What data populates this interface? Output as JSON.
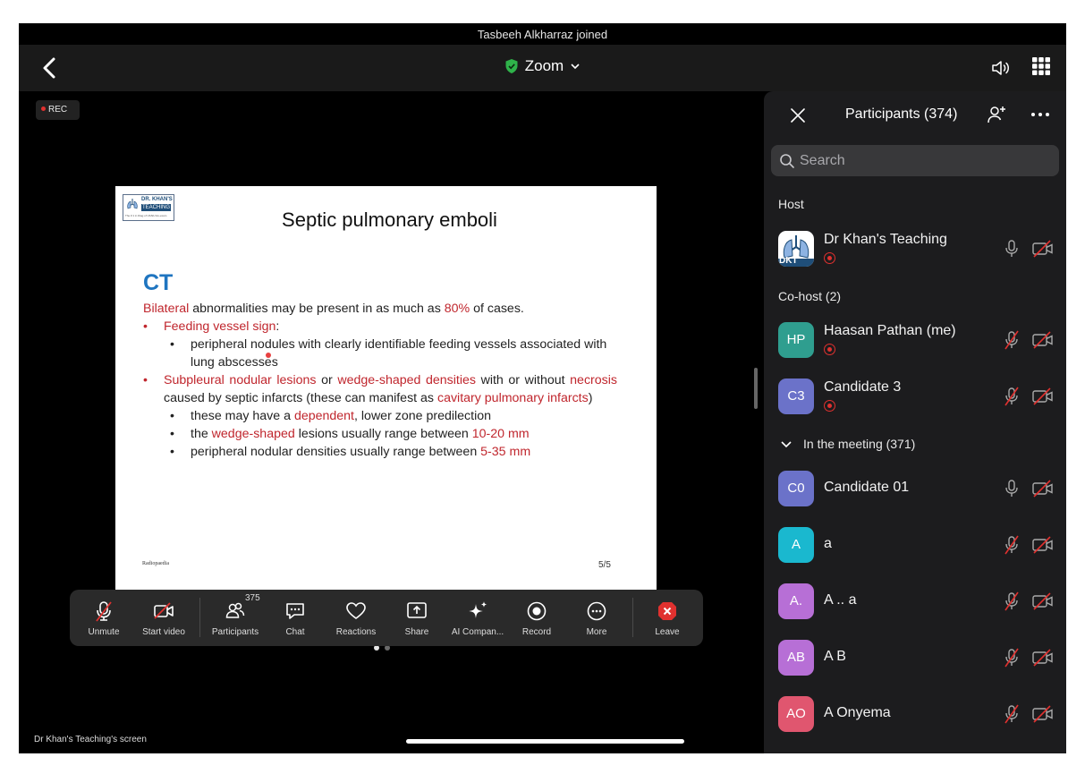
{
  "notification": "Tasbeeh Alkharraz joined",
  "header": {
    "app_title": "Zoom"
  },
  "recording_badge": "REC",
  "slide": {
    "logo_title": "DR. KHAN'S",
    "logo_subtitle": "TEACHING",
    "logo_small": "The # 1 in Diag of UK/EU Ex-exam",
    "title": "Septic pulmonary emboli",
    "heading": "CT",
    "line1_red": "Bilateral",
    "line1_a": " abnormalities may be present in as much as ",
    "line1_red2": "80%",
    "line1_b": " of cases.",
    "bullet1_red": "Feeding vessel sign",
    "bullet1_b": ":",
    "sub1": "peripheral nodules with clearly identifiable feeding vessels associated with lung abscesses",
    "bullet2_red1": "Subpleural nodular lesions",
    "bullet2_a": " or ",
    "bullet2_red2": "wedge-shaped densities",
    "bullet2_b": " with or without ",
    "bullet2_red3": "necrosis",
    "bullet2_c": " caused by septic infarcts (these can manifest as ",
    "bullet2_red4": "cavitary pulmonary infarcts",
    "bullet2_d": ")",
    "sub2_a": "these may have a ",
    "sub2_red": "dependent",
    "sub2_b": ", lower zone predilection",
    "sub3_a": "the ",
    "sub3_red": "wedge-shaped",
    "sub3_b": " lesions usually range between ",
    "sub3_red2": "10-20 mm",
    "sub4_a": "peripheral nodular densities usually range between ",
    "sub4_red": "5-35 mm",
    "footer": "Radiopaedia",
    "page": "5/5"
  },
  "toolbar": {
    "unmute": "Unmute",
    "start_video": "Start video",
    "participants": "Participants",
    "participants_count": "375",
    "chat": "Chat",
    "reactions": "Reactions",
    "share": "Share",
    "ai_companion": "AI Compan...",
    "record": "Record",
    "more": "More",
    "leave": "Leave"
  },
  "screen_label": "Dr Khan's Teaching's screen",
  "panel": {
    "title": "Participants (374)",
    "search_placeholder": "Search",
    "host_label": "Host",
    "cohost_label": "Co-host (2)",
    "meeting_label": "In the meeting (371)",
    "host": {
      "name": "Dr Khan's Teaching",
      "avatar_text": "DKT"
    },
    "cohosts": [
      {
        "initials": "HP",
        "name": "Haasan Pathan (me)",
        "color": "#2f9e8f"
      },
      {
        "initials": "C3",
        "name": "Candidate 3",
        "color": "#6b72c9"
      }
    ],
    "attendees": [
      {
        "initials": "C0",
        "name": "Candidate 01",
        "color": "#6b72c9",
        "muted": false
      },
      {
        "initials": "A",
        "name": "a",
        "color": "#1ab8cf",
        "muted": true
      },
      {
        "initials": "A.",
        "name": "A .. a",
        "color": "#b76fd6",
        "muted": true
      },
      {
        "initials": "AB",
        "name": "A B",
        "color": "#b76fd6",
        "muted": true
      },
      {
        "initials": "AO",
        "name": "A Onyema",
        "color": "#e0566f",
        "muted": true
      }
    ]
  },
  "colors": {
    "accent_red": "#c0262d",
    "rec_red": "#e0312f",
    "shield_green": "#2fb34a",
    "leave_red": "#e0312f",
    "ct_blue": "#1f75c0"
  }
}
